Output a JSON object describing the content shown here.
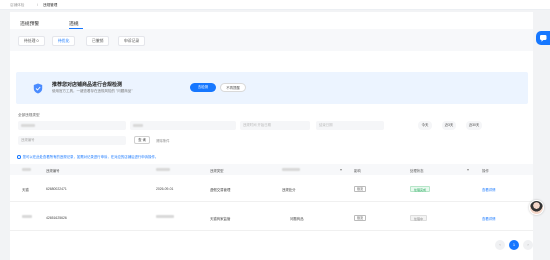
{
  "breadcrumb": {
    "home": "店铺体检",
    "separator": "/",
    "current": "违规管理"
  },
  "top_tabs": [
    {
      "label": "违规预警"
    },
    {
      "label": "违规"
    }
  ],
  "filter_tabs": [
    {
      "label": "待处理 0"
    },
    {
      "label": "待优化"
    },
    {
      "label": "已撤销"
    },
    {
      "label": "申诉记录"
    }
  ],
  "banner": {
    "title": "推荐您对店铺商品进行合规检测",
    "subtitle": "使用官方工具，一键查看存在违规风险的 \"问题商品\"",
    "primary_button": "去检测",
    "secondary_button": "不再提醒"
  },
  "form": {
    "section_label": "全部违规类型",
    "fields": [
      "",
      "",
      "违规时间  开始日期",
      "结束日期"
    ],
    "quick_dates": [
      "今天",
      "近3天",
      "近30天"
    ],
    "search_input_placeholder": "违规编号",
    "query_button": "查 询",
    "reset_link": "清除条件"
  },
  "notice": "您可以在此处查看所有的违规记录，如需对记录进行申诉，在对应的店铺后进行申诉操作。",
  "table": {
    "headers": [
      "",
      "违规编号",
      "",
      "违规类型",
      "",
      "影响",
      "处理状态",
      "操作"
    ],
    "rows": [
      {
        "col0": "天猫",
        "id": "62680022471",
        "date": "2026-09-01",
        "type": "虚假交易管理",
        "subtype": "违规处分",
        "effect": "限流",
        "status": "处理完成",
        "status_color": "green",
        "action": "查看详情"
      },
      {
        "col0": "",
        "id": "42651625626",
        "date": "",
        "type": "天猫商家监管",
        "subtype": "问题商品",
        "effect": "限流",
        "status": "处理中",
        "status_color": "grey",
        "action": "查看详情"
      }
    ]
  },
  "pagination": {
    "prev": "‹",
    "page": "1",
    "next": "›"
  },
  "colors": {
    "accent": "#1677ff",
    "banner_bg": "#ecf4ff",
    "status_green": "#21a85a"
  },
  "icons": {
    "banner": "shield-check-icon",
    "side_tab": "chat-icon",
    "prev": "chevron-left-icon",
    "next": "chevron-right-icon"
  }
}
